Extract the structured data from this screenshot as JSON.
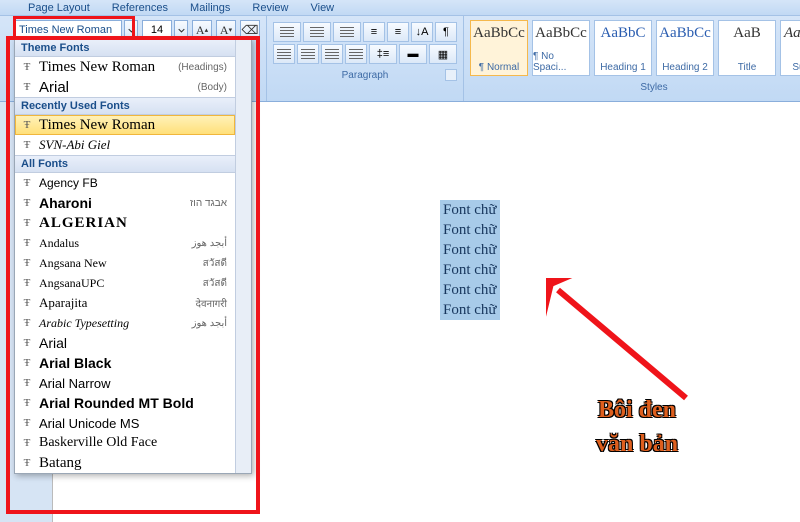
{
  "menubar": [
    "Page Layout",
    "References",
    "Mailings",
    "Review",
    "View"
  ],
  "font": {
    "name": "Times New Roman",
    "size": "14"
  },
  "paragraph_label": "Paragraph",
  "styles_label": "Styles",
  "styles": [
    {
      "sample": "AaBbCc",
      "name": "¶ Normal",
      "sel": true,
      "cls": ""
    },
    {
      "sample": "AaBbCc",
      "name": "¶ No Spaci...",
      "sel": false,
      "cls": ""
    },
    {
      "sample": "AaBbC",
      "name": "Heading 1",
      "sel": false,
      "cls": "blue"
    },
    {
      "sample": "AaBbCc",
      "name": "Heading 2",
      "sel": false,
      "cls": "blue"
    },
    {
      "sample": "AaB",
      "name": "Title",
      "sel": false,
      "cls": ""
    },
    {
      "sample": "AaBbCc",
      "name": "Subtitle",
      "sel": false,
      "cls": "ital"
    }
  ],
  "dropdown": {
    "theme_head": "Theme Fonts",
    "theme": [
      {
        "name": "Times New Roman",
        "tag": "(Headings)",
        "ff": "Times New Roman,serif",
        "size": "15px"
      },
      {
        "name": "Arial",
        "tag": "(Body)",
        "ff": "Arial,sans-serif",
        "size": "15px"
      }
    ],
    "recent_head": "Recently Used Fonts",
    "recent": [
      {
        "name": "Times New Roman",
        "tag": "",
        "ff": "Times New Roman,serif",
        "size": "15px",
        "hover": true
      },
      {
        "name": "SVN-Abi Giel",
        "tag": "",
        "ff": "cursive",
        "size": "13px",
        "style": "italic"
      }
    ],
    "all_head": "All Fonts",
    "all": [
      {
        "name": "Agency FB",
        "tag": "",
        "ff": "Arial Narrow,sans-serif",
        "size": "12px"
      },
      {
        "name": "Aharoni",
        "tag": "אבגד הוז",
        "ff": "Arial Black,sans-serif",
        "size": "14px",
        "bold": true
      },
      {
        "name": "ALGERIAN",
        "tag": "",
        "ff": "serif",
        "size": "15px",
        "bold": true,
        "ls": "1px"
      },
      {
        "name": "Andalus",
        "tag": "أبجد هوز",
        "ff": "Times New Roman,serif",
        "size": "12px"
      },
      {
        "name": "Angsana New",
        "tag": "สวัสดี",
        "ff": "serif",
        "size": "12px"
      },
      {
        "name": "AngsanaUPC",
        "tag": "สวัสดี",
        "ff": "serif",
        "size": "12px"
      },
      {
        "name": "Aparajita",
        "tag": "देवनागरी",
        "ff": "serif",
        "size": "13px"
      },
      {
        "name": "Arabic Typesetting",
        "tag": "أبجد هوز",
        "ff": "serif",
        "size": "12px",
        "style": "italic"
      },
      {
        "name": "Arial",
        "tag": "",
        "ff": "Arial,sans-serif",
        "size": "14px"
      },
      {
        "name": "Arial Black",
        "tag": "",
        "ff": "Arial Black,sans-serif",
        "size": "14px",
        "bold": true
      },
      {
        "name": "Arial Narrow",
        "tag": "",
        "ff": "Arial Narrow,sans-serif",
        "size": "13px"
      },
      {
        "name": "Arial Rounded MT Bold",
        "tag": "",
        "ff": "Arial,sans-serif",
        "size": "14px",
        "bold": true
      },
      {
        "name": "Arial Unicode MS",
        "tag": "",
        "ff": "Arial,sans-serif",
        "size": "13px"
      },
      {
        "name": "Baskerville Old Face",
        "tag": "",
        "ff": "Baskerville,serif",
        "size": "14px"
      },
      {
        "name": "Batang",
        "tag": "",
        "ff": "serif",
        "size": "15px"
      }
    ]
  },
  "doc_lines": [
    "Font chữ",
    "Font chữ",
    "Font chữ",
    "Font chữ",
    "Font chữ",
    "Font chữ"
  ],
  "annotation": {
    "line1": "Bôi đen",
    "line2": "văn bản"
  }
}
